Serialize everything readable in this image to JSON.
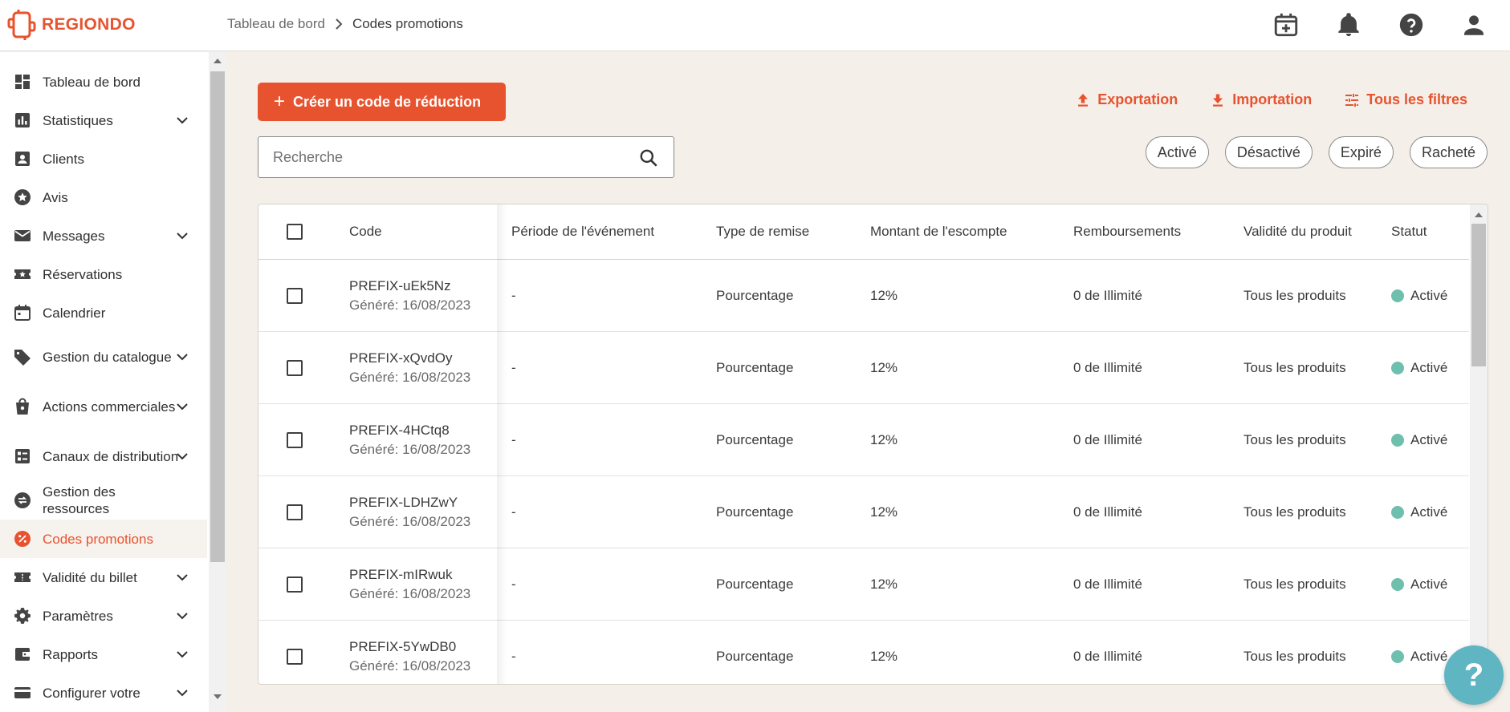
{
  "brand": {
    "name": "REGIONDO",
    "color": "#e8532f"
  },
  "breadcrumb": {
    "parent": "Tableau de bord",
    "current": "Codes promotions"
  },
  "header_icons": [
    "calendar-add-icon",
    "bell-icon",
    "help-circle-icon",
    "account-icon"
  ],
  "sidebar": {
    "items": [
      {
        "label": "Tableau de bord",
        "icon": "dashboard-icon",
        "expandable": false
      },
      {
        "label": "Statistiques",
        "icon": "bar-chart-icon",
        "expandable": true
      },
      {
        "label": "Clients",
        "icon": "contact-icon",
        "expandable": false
      },
      {
        "label": "Avis",
        "icon": "star-circle-icon",
        "expandable": false
      },
      {
        "label": "Messages",
        "icon": "mail-icon",
        "expandable": true
      },
      {
        "label": "Réservations",
        "icon": "ticket-star-icon",
        "expandable": false
      },
      {
        "label": "Calendrier",
        "icon": "calendar-icon",
        "expandable": false
      },
      {
        "label": "Gestion du catalogue",
        "icon": "tag-icon",
        "expandable": true
      },
      {
        "label": "Actions commerciales",
        "icon": "shopping-bag-icon",
        "expandable": true
      },
      {
        "label": "Canaux de distribution",
        "icon": "channels-icon",
        "expandable": true
      },
      {
        "label": "Gestion des ressources",
        "icon": "swap-icon",
        "expandable": false
      },
      {
        "label": "Codes promotions",
        "icon": "percent-icon",
        "expandable": false,
        "active": true
      },
      {
        "label": "Validité du billet",
        "icon": "ticket-icon",
        "expandable": true
      },
      {
        "label": "Paramètres",
        "icon": "gear-icon",
        "expandable": true
      },
      {
        "label": "Rapports",
        "icon": "wallet-icon",
        "expandable": true
      },
      {
        "label": "Configurer votre",
        "icon": "card-icon",
        "expandable": true
      }
    ]
  },
  "toolbar": {
    "create_label": "Créer un code de réduction",
    "export_label": "Exportation",
    "import_label": "Importation",
    "filters_label": "Tous les filtres"
  },
  "search": {
    "placeholder": "Recherche"
  },
  "filters": [
    "Activé",
    "Désactivé",
    "Expiré",
    "Racheté"
  ],
  "table": {
    "headers": {
      "code": "Code",
      "period": "Période de l'événement",
      "discount_type": "Type de remise",
      "amount": "Montant de l'escompte",
      "refunds": "Remboursements",
      "validity": "Validité du produit",
      "status": "Statut"
    },
    "rows": [
      {
        "code": "PREFIX-uEk5Nz",
        "generated": "Généré: 16/08/2023",
        "period": "-",
        "discount_type": "Pourcentage",
        "amount": "12%",
        "refunds": "0 de Illimité",
        "validity": "Tous les produits",
        "status": "Activé"
      },
      {
        "code": "PREFIX-xQvdOy",
        "generated": "Généré: 16/08/2023",
        "period": "-",
        "discount_type": "Pourcentage",
        "amount": "12%",
        "refunds": "0 de Illimité",
        "validity": "Tous les produits",
        "status": "Activé"
      },
      {
        "code": "PREFIX-4HCtq8",
        "generated": "Généré: 16/08/2023",
        "period": "-",
        "discount_type": "Pourcentage",
        "amount": "12%",
        "refunds": "0 de Illimité",
        "validity": "Tous les produits",
        "status": "Activé"
      },
      {
        "code": "PREFIX-LDHZwY",
        "generated": "Généré: 16/08/2023",
        "period": "-",
        "discount_type": "Pourcentage",
        "amount": "12%",
        "refunds": "0 de Illimité",
        "validity": "Tous les produits",
        "status": "Activé"
      },
      {
        "code": "PREFIX-mIRwuk",
        "generated": "Généré: 16/08/2023",
        "period": "-",
        "discount_type": "Pourcentage",
        "amount": "12%",
        "refunds": "0 de Illimité",
        "validity": "Tous les produits",
        "status": "Activé"
      },
      {
        "code": "PREFIX-5YwDB0",
        "generated": "Généré: 16/08/2023",
        "period": "-",
        "discount_type": "Pourcentage",
        "amount": "12%",
        "refunds": "0 de Illimité",
        "validity": "Tous les produits",
        "status": "Activé"
      }
    ]
  },
  "colors": {
    "accent": "#e8532f",
    "status_active": "#6fbfae",
    "help_fab": "#5fb5c1",
    "background": "#f4efe9"
  },
  "help_fab": {
    "label": "?"
  }
}
